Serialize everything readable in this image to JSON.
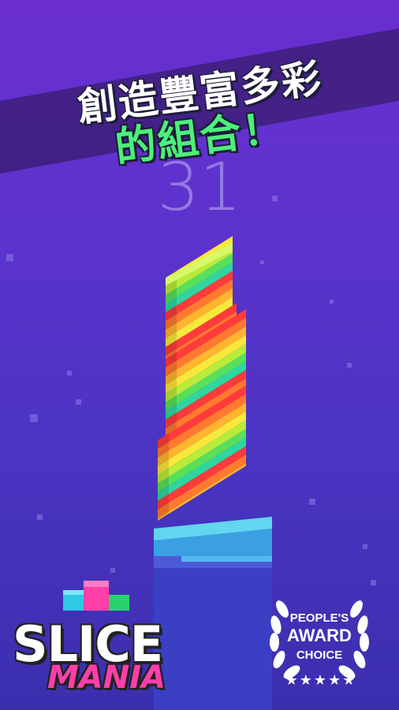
{
  "headline": {
    "line1": "創造豐富多彩",
    "line2": "的組合！"
  },
  "score": "31",
  "logo": {
    "word1": "SLICE",
    "word2": "MANIA"
  },
  "award": {
    "line1": "PEOPLE'S",
    "line2": "AWARD",
    "line3": "CHOICE",
    "stars": "★★★★★"
  },
  "colors": {
    "background_top": "#6a2ed0",
    "background_bottom": "#3b2fae",
    "headline_main": "#ffffff",
    "headline_accent": "#4cf07a",
    "score": "#9d86e6",
    "logo_mania": "#ff3fa8"
  }
}
